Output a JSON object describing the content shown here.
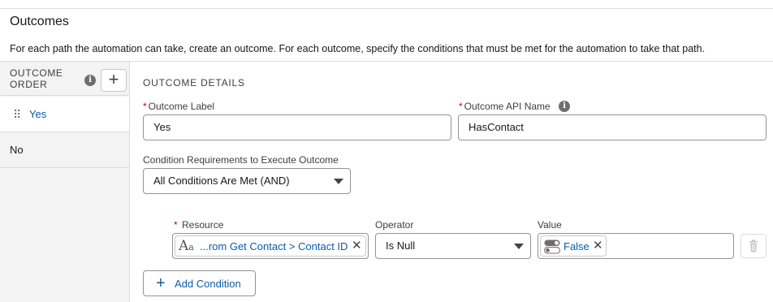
{
  "section": {
    "title": "Outcomes",
    "description": "For each path the automation can take, create an outcome. For each outcome, specify the conditions that must be met for the automation to take that path."
  },
  "sidebar": {
    "header_line1": "OUTCOME",
    "header_line2": "ORDER",
    "add_symbol": "+",
    "items": [
      {
        "label": "Yes",
        "selected": true
      },
      {
        "label": "No",
        "selected": false
      }
    ]
  },
  "details": {
    "title": "OUTCOME DETAILS",
    "required_marker": "*",
    "outcome_label": {
      "label": "Outcome Label",
      "value": "Yes"
    },
    "api_name": {
      "label": "Outcome API Name",
      "value": "HasContact"
    },
    "condition_requirements": {
      "label": "Condition Requirements to Execute Outcome",
      "value": "All Conditions Are Met (AND)"
    }
  },
  "condition": {
    "resource": {
      "label": "Resource",
      "value": "...rom Get Contact > Contact ID",
      "icon": "text-type-icon"
    },
    "operator": {
      "label": "Operator",
      "value": "Is Null"
    },
    "value": {
      "label": "Value",
      "value": "False",
      "icon": "boolean-toggle-icon"
    }
  },
  "add_condition": {
    "label": "Add Condition",
    "symbol": "+"
  },
  "icons": {
    "info_glyph": "i",
    "close_glyph": "✕"
  },
  "colors": {
    "link_blue": "#0b5cab",
    "required_red": "#ba0517",
    "sidebar_bg": "#f3f3f3"
  }
}
